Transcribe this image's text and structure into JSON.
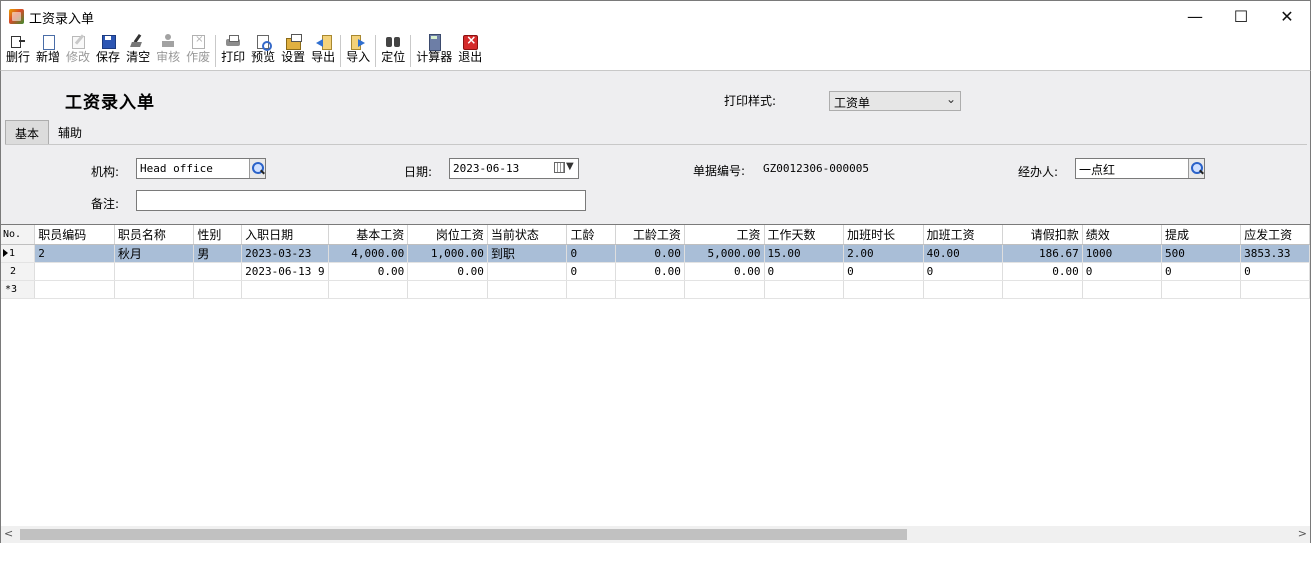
{
  "window": {
    "title": "工资录入单",
    "minimize": "—",
    "maximize": "☐",
    "close": "✕"
  },
  "toolbar": [
    {
      "label": "删行",
      "icon": "delete-row-icon",
      "enabled": true
    },
    {
      "label": "新增",
      "icon": "new-doc-icon",
      "enabled": true
    },
    {
      "label": "修改",
      "icon": "edit-icon",
      "enabled": false
    },
    {
      "label": "保存",
      "icon": "save-icon",
      "enabled": true
    },
    {
      "label": "清空",
      "icon": "broom-icon",
      "enabled": true
    },
    {
      "label": "审核",
      "icon": "stamp-icon",
      "enabled": false
    },
    {
      "label": "作废",
      "icon": "void-icon",
      "enabled": false
    },
    {
      "label": "打印",
      "icon": "printer-icon",
      "enabled": true
    },
    {
      "label": "预览",
      "icon": "preview-icon",
      "enabled": true
    },
    {
      "label": "设置",
      "icon": "settings-icon",
      "enabled": true
    },
    {
      "label": "导出",
      "icon": "export-icon",
      "enabled": true
    },
    {
      "label": "导入",
      "icon": "import-icon",
      "enabled": true
    },
    {
      "label": "定位",
      "icon": "binoculars-icon",
      "enabled": true
    },
    {
      "label": "计算器",
      "icon": "calculator-icon",
      "enabled": true
    },
    {
      "label": "退出",
      "icon": "exit-icon",
      "enabled": true
    }
  ],
  "form": {
    "title": "工资录入单",
    "print_style_label": "打印样式:",
    "print_style_value": "工资单",
    "tabs": [
      "基本",
      "辅助"
    ],
    "org_label": "机构:",
    "org_value": "Head office",
    "date_label": "日期:",
    "date_value": "2023-06-13",
    "doc_no_label": "单据编号:",
    "doc_no_value": "GZ0012306-000005",
    "handler_label": "经办人:",
    "handler_value": "一点红",
    "remark_label": "备注:",
    "remark_value": ""
  },
  "grid": {
    "columns": [
      "No.",
      "职员编码",
      "职员名称",
      "性别",
      "入职日期",
      "基本工资",
      "岗位工资",
      "当前状态",
      "工龄",
      "工龄工资",
      "工资",
      "工作天数",
      "加班时长",
      "加班工资",
      "请假扣款",
      "绩效",
      "提成",
      "应发工资"
    ],
    "rows": [
      {
        "no": "1",
        "cells": [
          "2",
          "秋月",
          "男",
          "2023-03-23",
          "4,000.00",
          "1,000.00",
          "到职",
          "0",
          "0.00",
          "5,000.00",
          "15.00",
          "2.00",
          "40.00",
          "186.67",
          "1000",
          "500",
          "3853.33"
        ]
      },
      {
        "no": "2",
        "cells": [
          "",
          "",
          "",
          "2023-06-13 9",
          "0.00",
          "0.00",
          "",
          "0",
          "0.00",
          "0.00",
          "0",
          "0",
          "0",
          "0.00",
          "0",
          "0",
          "0"
        ]
      },
      {
        "no": "*3",
        "cells": [
          "",
          "",
          "",
          "",
          "",
          "",
          "",
          "",
          "",
          "",
          "",
          "",
          "",
          "",
          "",
          "",
          ""
        ]
      }
    ]
  },
  "scrollbar": {
    "left_arrow": "<",
    "right_arrow": ">"
  }
}
